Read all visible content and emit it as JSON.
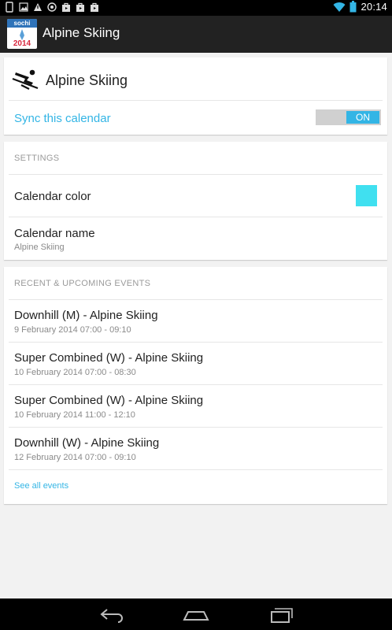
{
  "status_bar": {
    "time": "20:14",
    "left_icons": [
      "sim-icon",
      "image-icon",
      "warning-icon",
      "chrome-icon",
      "bag-icon",
      "bag-icon",
      "bag-icon"
    ],
    "right_icons": [
      "wifi-icon",
      "battery-icon"
    ]
  },
  "action_bar": {
    "title": "Alpine Skiing",
    "logo": {
      "top_text": "sochi",
      "bottom_text": "2014"
    }
  },
  "calendar": {
    "name": "Alpine Skiing",
    "sync_label": "Sync this calendar",
    "sync_state": "ON"
  },
  "settings": {
    "header": "SETTINGS",
    "color_label": "Calendar color",
    "color_value": "#40e0f0",
    "name_label": "Calendar name",
    "name_value": "Alpine Skiing"
  },
  "events": {
    "header": "RECENT & UPCOMING EVENTS",
    "items": [
      {
        "title": "Downhill (M) - Alpine Skiing",
        "time": "9 February 2014 07:00 - 09:10"
      },
      {
        "title": "Super Combined (W) - Alpine Skiing",
        "time": "10 February 2014 07:00 - 08:30"
      },
      {
        "title": "Super Combined (W) - Alpine Skiing",
        "time": "10 February 2014 11:00 - 12:10"
      },
      {
        "title": "Downhill (W) - Alpine Skiing",
        "time": "12 February 2014 07:00 - 09:10"
      }
    ],
    "see_all": "See all events"
  },
  "nav_bar": {
    "buttons": [
      "back-icon",
      "home-icon",
      "recent-apps-icon"
    ]
  },
  "colors": {
    "accent": "#33b5e5",
    "action_bar": "#222222",
    "background": "#f2f2f2"
  }
}
